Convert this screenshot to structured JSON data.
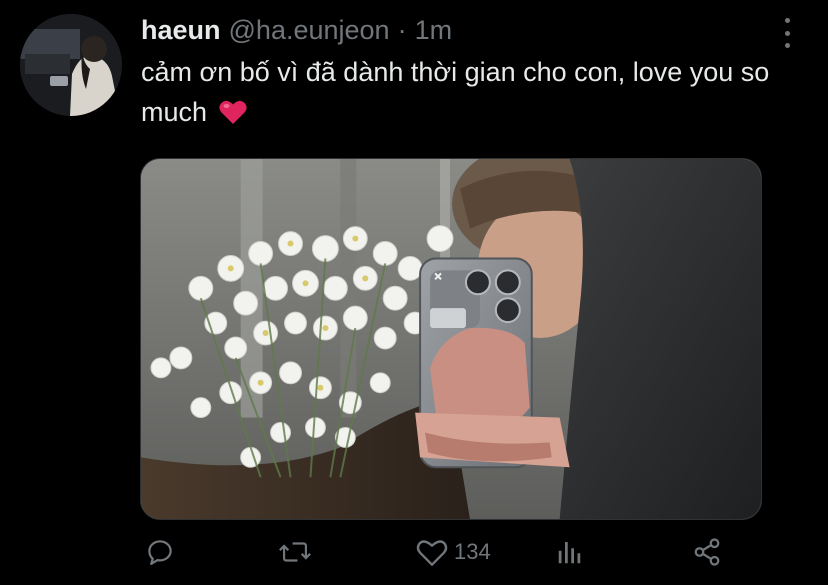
{
  "tweet": {
    "display_name": "haeun",
    "handle": "@ha.eunjeon",
    "separator": "·",
    "time": "1m",
    "text": "cảm ơn bố vì đã dành thời gian cho con, love you so much",
    "emoji": "heart-emoji",
    "media_alt": "Mirror selfie of a person holding a phone and a bouquet of white daisies"
  },
  "actions": {
    "reply_icon": "reply-icon",
    "retweet_icon": "retweet-icon",
    "like_icon": "heart-icon",
    "like_count": "134",
    "analytics_icon": "analytics-icon",
    "share_icon": "share-icon"
  },
  "menu_icon": "more-icon",
  "colors": {
    "background": "#000000",
    "text": "#e7e9ea",
    "secondary": "#71767b",
    "heart": "#e0245e"
  }
}
